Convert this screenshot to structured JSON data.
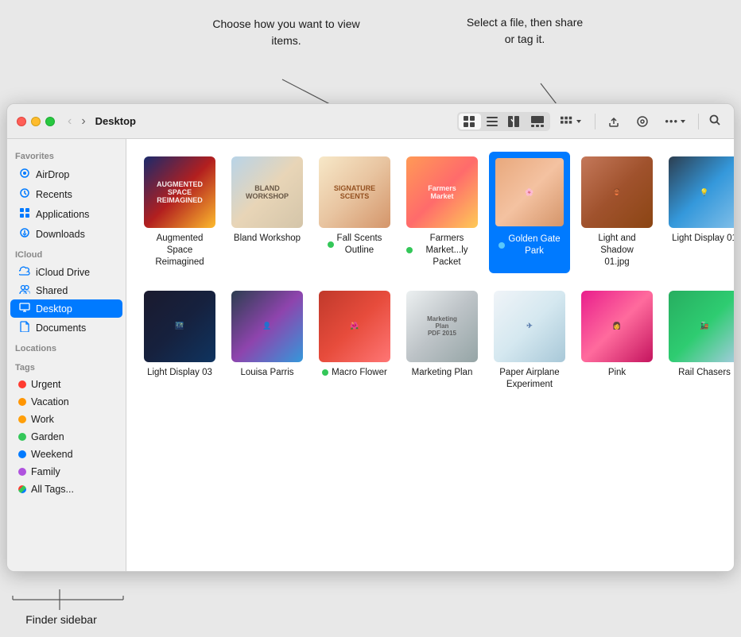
{
  "annotations": {
    "callout1": {
      "text": "Choose how you\nwant to view items.",
      "label": "choose-view-callout"
    },
    "callout2": {
      "text": "Select a file,\nthen share\nor tag it.",
      "label": "share-tag-callout"
    },
    "callout3": {
      "text": "Finder sidebar",
      "label": "sidebar-callout"
    }
  },
  "window": {
    "title": "Desktop"
  },
  "toolbar": {
    "back_label": "‹",
    "forward_label": "›",
    "view_icon": "⊞",
    "list_icon": "☰",
    "column_icon": "⊟",
    "gallery_icon": "⊡",
    "group_icon": "⊞",
    "share_icon": "↑",
    "tag_icon": "◉",
    "more_icon": "•••",
    "search_icon": "⌕"
  },
  "sidebar": {
    "sections": [
      {
        "label": "Favorites",
        "items": [
          {
            "id": "airdrop",
            "name": "AirDrop",
            "icon": "📡"
          },
          {
            "id": "recents",
            "name": "Recents",
            "icon": "🕐"
          },
          {
            "id": "applications",
            "name": "Applications",
            "icon": "🚀"
          },
          {
            "id": "downloads",
            "name": "Downloads",
            "icon": "⬇"
          }
        ]
      },
      {
        "label": "iCloud",
        "items": [
          {
            "id": "icloud-drive",
            "name": "iCloud Drive",
            "icon": "☁"
          },
          {
            "id": "shared",
            "name": "Shared",
            "icon": "👥"
          },
          {
            "id": "desktop",
            "name": "Desktop",
            "icon": "🖥",
            "active": true
          },
          {
            "id": "documents",
            "name": "Documents",
            "icon": "📄"
          }
        ]
      },
      {
        "label": "Locations",
        "items": []
      },
      {
        "label": "Tags",
        "items": [
          {
            "id": "tag-urgent",
            "name": "Urgent",
            "tagColor": "#ff3b30"
          },
          {
            "id": "tag-vacation",
            "name": "Vacation",
            "tagColor": "#ff9500"
          },
          {
            "id": "tag-work",
            "name": "Work",
            "tagColor": "#ff9f0a"
          },
          {
            "id": "tag-garden",
            "name": "Garden",
            "tagColor": "#34c759"
          },
          {
            "id": "tag-weekend",
            "name": "Weekend",
            "tagColor": "#007aff"
          },
          {
            "id": "tag-family",
            "name": "Family",
            "tagColor": "#af52de"
          },
          {
            "id": "tag-alltags",
            "name": "All Tags...",
            "tagColor": "#aaa"
          }
        ]
      }
    ]
  },
  "files": {
    "row1": [
      {
        "id": "augmented",
        "name": "Augmented\nSpace Reimagined",
        "thumbClass": "thumb-aug",
        "tag": null
      },
      {
        "id": "bland",
        "name": "Bland Workshop",
        "thumbClass": "thumb-bland",
        "tag": null
      },
      {
        "id": "fall",
        "name": "Fall Scents\nOutline",
        "thumbClass": "thumb-fall",
        "tag": "#34c759"
      },
      {
        "id": "farmers",
        "name": "Farmers\nMarket...ly Packet",
        "thumbClass": "thumb-farmers",
        "tag": "#34c759"
      },
      {
        "id": "golden",
        "name": "Golden Gate\nPark",
        "thumbClass": "thumb-golden",
        "tag": "#007aff",
        "selected": true
      },
      {
        "id": "lshadow",
        "name": "Light and Shadow\n01.jpg",
        "thumbClass": "thumb-lshadow",
        "tag": null
      },
      {
        "id": "ldisplay01",
        "name": "Light Display 01",
        "thumbClass": "thumb-ldisplay01",
        "tag": null
      }
    ],
    "row2": [
      {
        "id": "ldisplay03",
        "name": "Light Display 03",
        "thumbClass": "thumb-ldisplay03",
        "tag": null
      },
      {
        "id": "louisa",
        "name": "Louisa Parris",
        "thumbClass": "thumb-louisa",
        "tag": null
      },
      {
        "id": "macro",
        "name": "Macro Flower",
        "thumbClass": "thumb-macro",
        "tag": "#34c759"
      },
      {
        "id": "marketing",
        "name": "Marketing Plan",
        "thumbClass": "thumb-marketing",
        "tag": null
      },
      {
        "id": "paper",
        "name": "Paper Airplane\nExperiment",
        "thumbClass": "thumb-paper",
        "tag": null
      },
      {
        "id": "pink",
        "name": "Pink",
        "thumbClass": "thumb-pink",
        "tag": null
      },
      {
        "id": "rail",
        "name": "Rail Chasers",
        "thumbClass": "thumb-rail",
        "tag": null
      }
    ]
  }
}
